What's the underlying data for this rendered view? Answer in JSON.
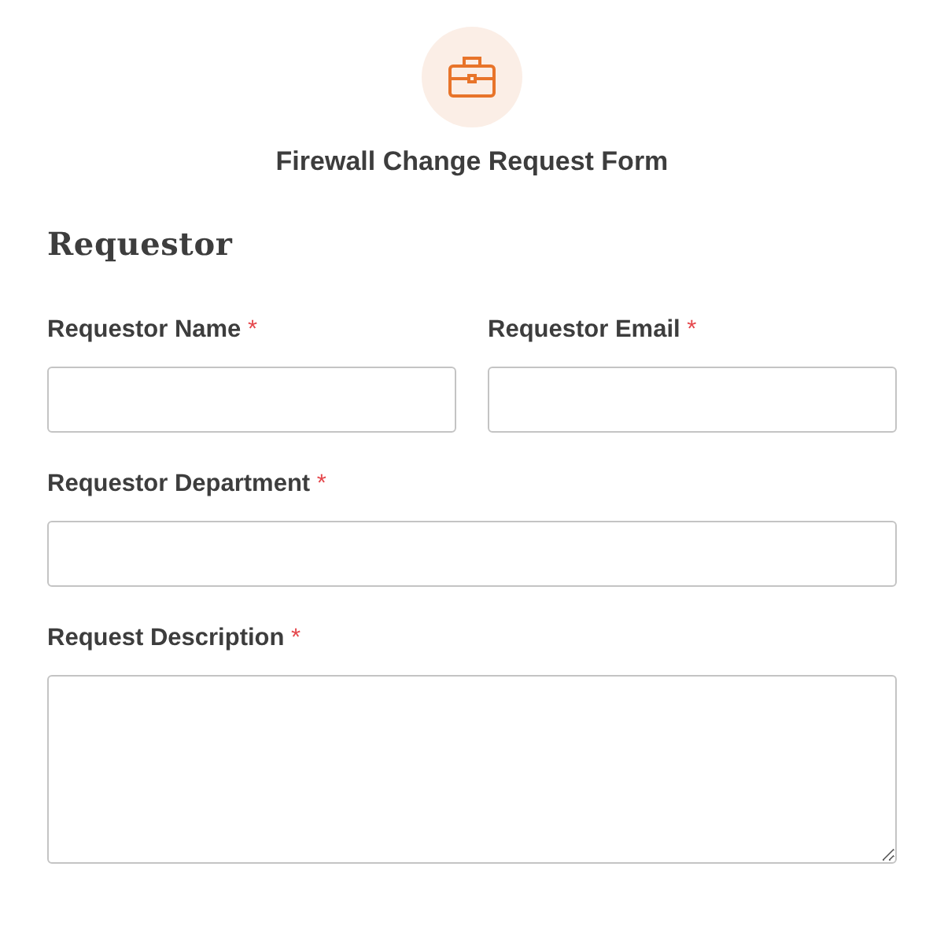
{
  "form": {
    "title": "Firewall Change Request Form"
  },
  "section": {
    "heading": "Requestor"
  },
  "rows": [
    {
      "fields": [
        {
          "label": "Requestor Name",
          "required_mark": "*",
          "kind": "text"
        },
        {
          "label": "Requestor Email",
          "required_mark": "*",
          "kind": "text"
        }
      ]
    },
    {
      "fields": [
        {
          "label": "Requestor Department",
          "required_mark": "*",
          "kind": "text"
        }
      ]
    },
    {
      "fields": [
        {
          "label": "Request Description",
          "required_mark": "*",
          "kind": "textarea"
        }
      ]
    }
  ]
}
